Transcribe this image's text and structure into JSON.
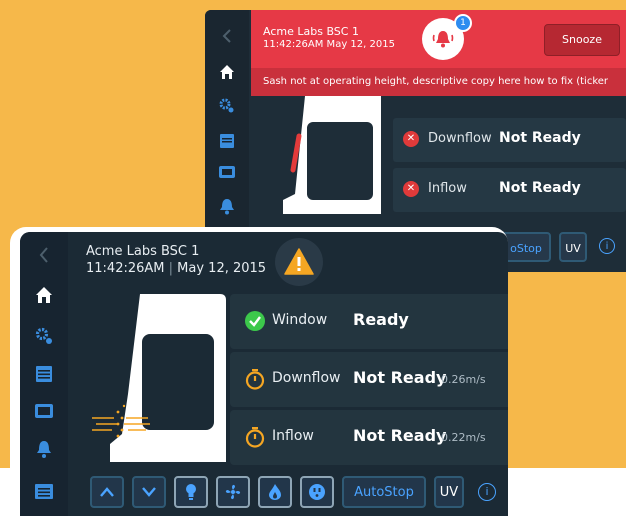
{
  "back_screen": {
    "device_name": "Acme Labs BSC 1",
    "datetime": "11:42:26AM  May 12, 2015",
    "notification_count": "1",
    "snooze_label": "Snooze",
    "ticker": "Sash not at operating height, descriptive copy here how to fix (ticker",
    "status": [
      {
        "name": "Downflow",
        "value": "Not Ready"
      },
      {
        "name": "Inflow",
        "value": "Not Ready"
      }
    ],
    "buttons": {
      "autostop": "oStop",
      "uv": "UV"
    }
  },
  "front_screen": {
    "device_name": "Acme Labs BSC 1",
    "time": "11:42:26AM",
    "date": "May 12, 2015",
    "status": [
      {
        "name": "Window",
        "value": "Ready",
        "unit": "",
        "icon": "check-icon"
      },
      {
        "name": "Downflow",
        "value": "Not Ready",
        "unit": "0.26m/s",
        "icon": "timer-icon"
      },
      {
        "name": "Inflow",
        "value": "Not Ready",
        "unit": "0.22m/s",
        "icon": "timer-icon"
      }
    ],
    "buttons": {
      "autostop": "AutoStop",
      "uv": "UV"
    }
  },
  "colors": {
    "background": "#f6b84a",
    "alert_red": "#e63946",
    "panel": "#1b2a35",
    "accent_blue": "#4aa3ff",
    "ok_green": "#3cc84b",
    "warning_orange": "#f5a623"
  }
}
